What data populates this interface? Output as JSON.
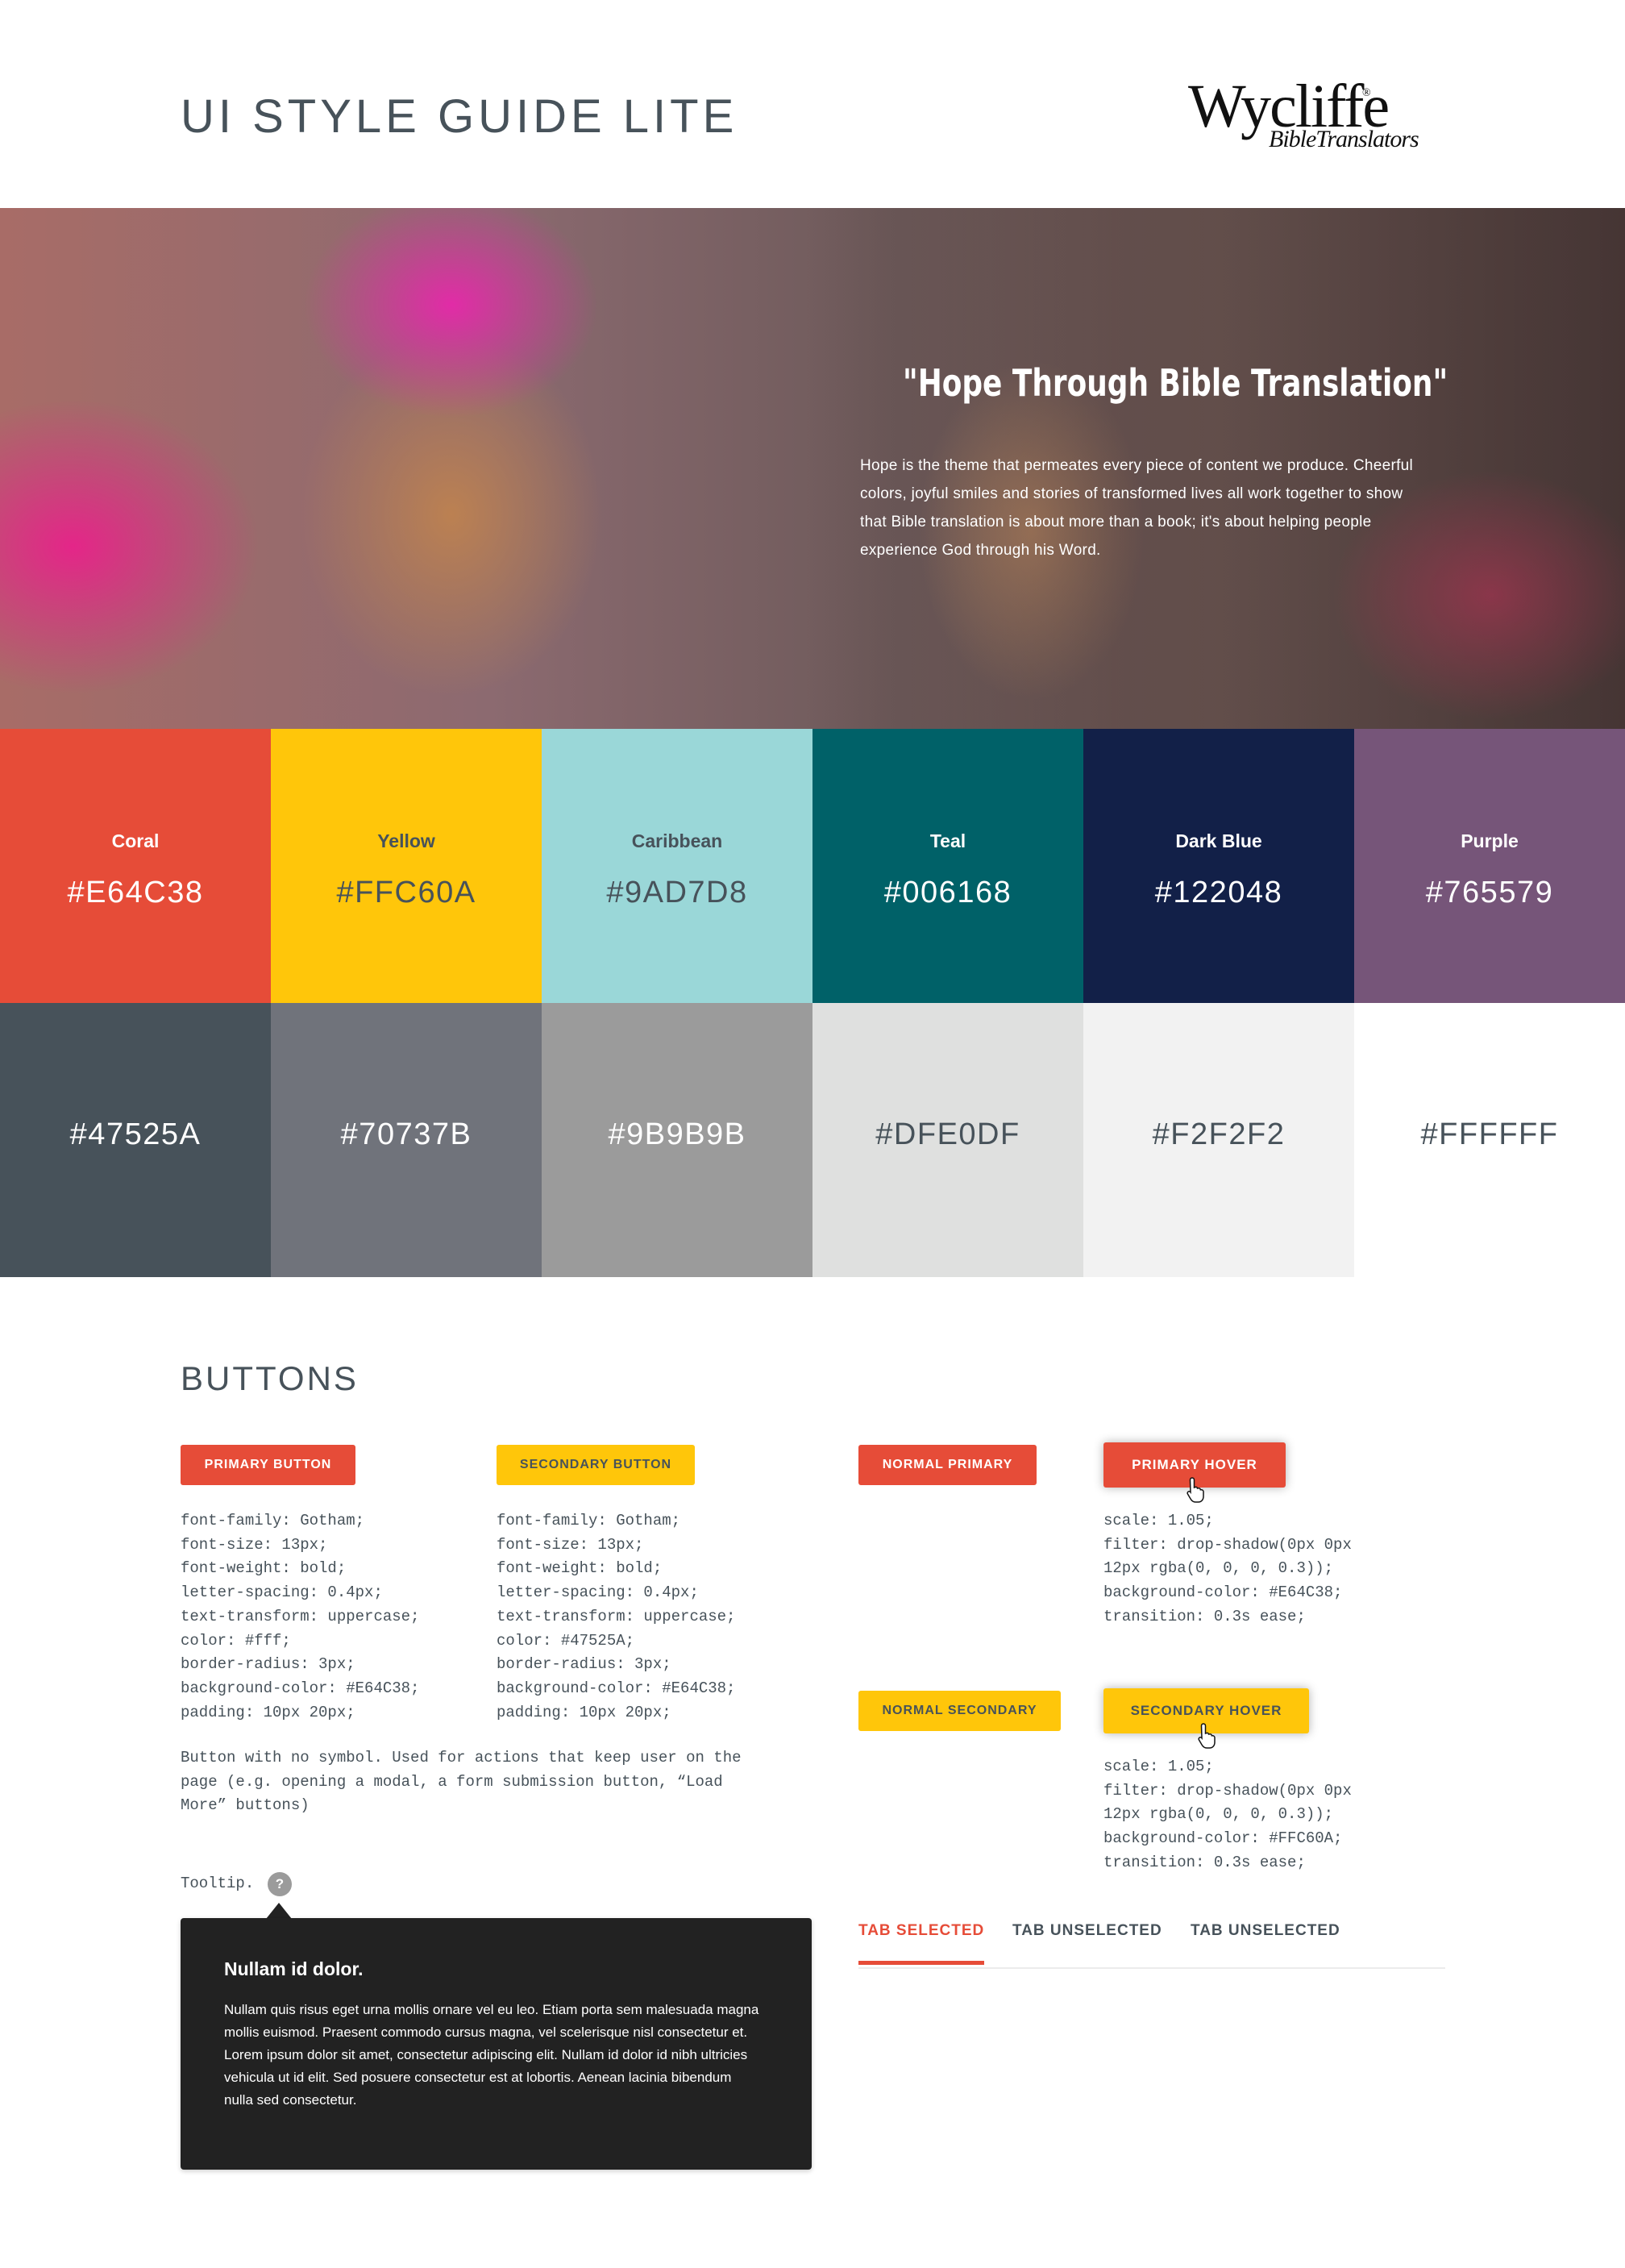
{
  "header": {
    "title": "UI STYLE GUIDE LITE",
    "logo": {
      "name": "Wycliffe",
      "registered": "®",
      "subtitle": "BibleTranslators"
    }
  },
  "hero": {
    "quote": "\"Hope Through Bible Translation\"",
    "body": "Hope is the theme that permeates every piece of content we produce. Cheerful colors, joyful smiles and stories of transformed lives all work together to show that Bible translation is about more than a book; it's about helping people experience God through his Word."
  },
  "palette": {
    "primary": [
      {
        "name": "Coral",
        "hex": "#E64C38",
        "text": "#ffffff"
      },
      {
        "name": "Yellow",
        "hex": "#FFC60A",
        "text": "#47525A"
      },
      {
        "name": "Caribbean",
        "hex": "#9AD7D8",
        "text": "#47525A"
      },
      {
        "name": "Teal",
        "hex": "#006168",
        "text": "#ffffff"
      },
      {
        "name": "Dark Blue",
        "hex": "#122048",
        "text": "#ffffff"
      },
      {
        "name": "Purple",
        "hex": "#765579",
        "text": "#ffffff"
      }
    ],
    "neutral": [
      {
        "hex": "#47525A",
        "text": "#ffffff"
      },
      {
        "hex": "#70737B",
        "text": "#ffffff"
      },
      {
        "hex": "#9B9B9B",
        "text": "#ffffff"
      },
      {
        "hex": "#DFE0DF",
        "text": "#47525A"
      },
      {
        "hex": "#F2F2F2",
        "text": "#47525A"
      },
      {
        "hex": "#FFFFFF",
        "text": "#47525A"
      }
    ]
  },
  "buttons_section": {
    "title": "BUTTONS",
    "primary_label": "PRIMARY BUTTON",
    "secondary_label": "SECONDARY BUTTON",
    "normal_primary_label": "NORMAL PRIMARY",
    "primary_hover_label": "PRIMARY HOVER",
    "normal_secondary_label": "NORMAL SECONDARY",
    "secondary_hover_label": "SECONDARY HOVER",
    "primary_css": "font-family: Gotham;\nfont-size: 13px;\nfont-weight: bold;\nletter-spacing: 0.4px;\ntext-transform: uppercase;\ncolor: #fff;\nborder-radius: 3px;\nbackground-color: #E64C38;\npadding: 10px 20px;",
    "secondary_css": "font-family: Gotham;\nfont-size: 13px;\nfont-weight: bold;\nletter-spacing: 0.4px;\ntext-transform: uppercase;\ncolor: #47525A;\nborder-radius: 3px;\nbackground-color: #E64C38;\npadding: 10px 20px;",
    "primary_hover_css": "scale: 1.05;\nfilter: drop-shadow(0px 0px\n12px rgba(0, 0, 0, 0.3));\nbackground-color: #E64C38;\ntransition: 0.3s ease;",
    "secondary_hover_css": "scale: 1.05;\nfilter: drop-shadow(0px 0px\n12px rgba(0, 0, 0, 0.3));\nbackground-color: #FFC60A;\ntransition: 0.3s ease;",
    "note": "Button with no symbol. Used for actions that keep user on the page (e.g. opening a modal, a form submission button, “Load More” buttons)"
  },
  "tooltip": {
    "label": "Tooltip.",
    "icon": "?",
    "title": "Nullam id dolor.",
    "body": "Nullam quis risus eget urna mollis ornare vel eu leo. Etiam porta sem malesuada magna mollis euismod. Praesent commodo cursus magna, vel scelerisque nisl consectetur et. Lorem ipsum dolor sit amet, consectetur adipiscing elit. Nullam id dolor id nibh ultricies vehicula ut id elit. Sed posuere consectetur est at lobortis. Aenean lacinia bibendum nulla sed consectetur."
  },
  "tabs": [
    {
      "label": "TAB SELECTED",
      "selected": true
    },
    {
      "label": "TAB UNSELECTED",
      "selected": false
    },
    {
      "label": "TAB UNSELECTED",
      "selected": false
    }
  ],
  "icons": {
    "cursor": "hand-pointer-icon",
    "help": "question-circle-icon"
  }
}
